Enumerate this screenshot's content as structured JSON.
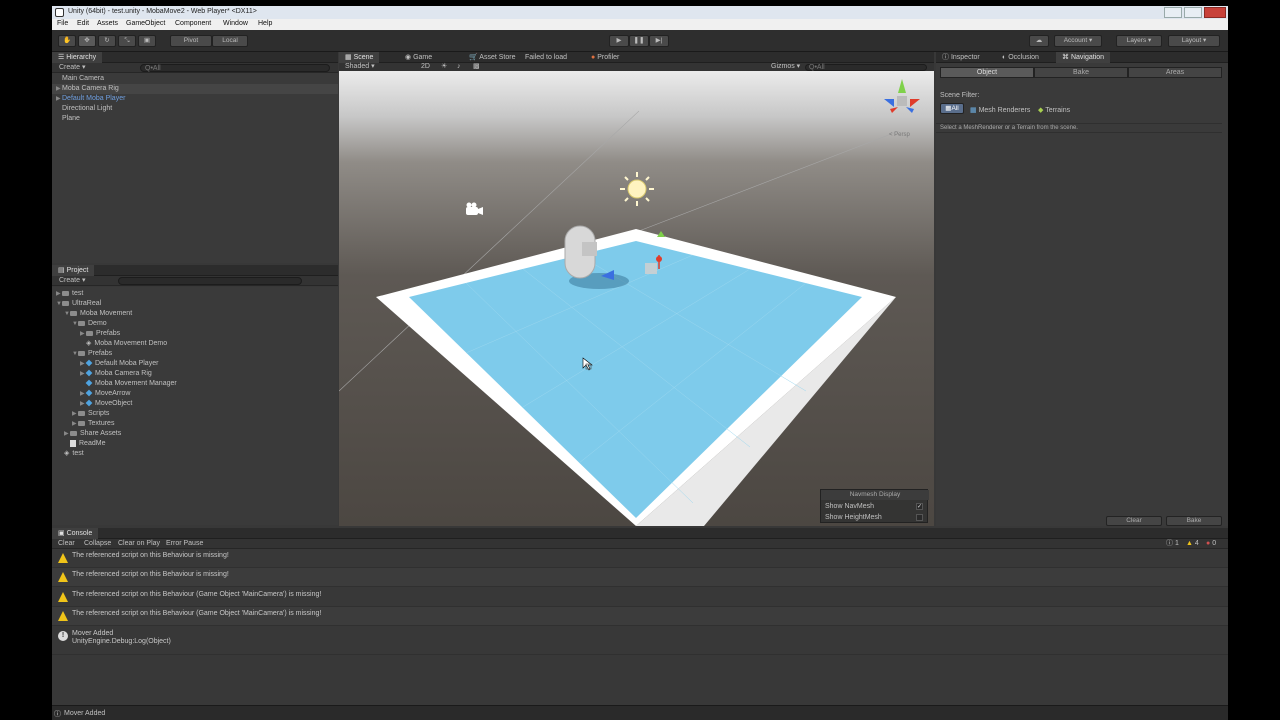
{
  "title": "Unity (64bit) - test.unity - MobaMove2 - Web Player* <DX11>",
  "menu": [
    "File",
    "Edit",
    "Assets",
    "GameObject",
    "Component",
    "Window",
    "Help"
  ],
  "toolbar": {
    "pivot": "Pivot",
    "local": "Local",
    "account": "Account",
    "layers": "Layers",
    "layout": "Layout"
  },
  "hierarchy": {
    "tab": "Hierarchy",
    "create": "Create",
    "search": "Q•All",
    "items": [
      "Main Camera",
      "Moba Camera Rig",
      "Default Moba Player",
      "Directional Light",
      "Plane"
    ]
  },
  "project": {
    "tab": "Project",
    "create": "Create",
    "items": [
      "test",
      "UltraReal",
      "Moba Movement",
      "Demo",
      "Prefabs",
      "Moba Movement Demo",
      "Prefabs",
      "Default Moba Player",
      "Moba Camera Rig",
      "Moba Movement Manager",
      "MoveArrow",
      "MoveObject",
      "Scripts",
      "Textures",
      "Share Assets",
      "ReadMe",
      "test"
    ]
  },
  "center_tabs": {
    "scene": "Scene",
    "game": "Game",
    "asset_store": "Asset Store",
    "failed": "Failed to load",
    "profiler": "Profiler"
  },
  "scene_bar": {
    "shaded": "Shaded",
    "twod": "2D",
    "gizmos": "Gizmos",
    "search": "Q•All",
    "persp": "< Persp"
  },
  "navmesh": {
    "title": "Navmesh Display",
    "show_navmesh": "Show NavMesh",
    "show_heightmesh": "Show HeightMesh"
  },
  "right_tabs": {
    "inspector": "Inspector",
    "occlusion": "Occlusion",
    "navigation": "Navigation"
  },
  "nav_tabs": {
    "object": "Object",
    "bake": "Bake",
    "areas": "Areas"
  },
  "scene_filter": {
    "label": "Scene Filter:",
    "all": "All",
    "mesh": "Mesh Renderers",
    "terrains": "Terrains",
    "hint": "Select a MeshRenderer or a Terrain from the scene."
  },
  "nav_buttons": {
    "clear": "Clear",
    "bake": "Bake"
  },
  "console": {
    "tab": "Console",
    "buttons": [
      "Clear",
      "Collapse",
      "Clear on Play",
      "Error Pause"
    ],
    "counts": {
      "info": "1",
      "warn": "4",
      "error": "0"
    },
    "rows": [
      {
        "type": "warn",
        "text": "The referenced script on this Behaviour is missing!"
      },
      {
        "type": "warn",
        "text": "The referenced script on this Behaviour is missing!"
      },
      {
        "type": "warn",
        "text": "The referenced script on this Behaviour (Game Object 'MainCamera') is missing!"
      },
      {
        "type": "warn",
        "text": "The referenced script on this Behaviour (Game Object 'MainCamera') is missing!"
      },
      {
        "type": "info",
        "text": "Mover Added",
        "text2": "UnityEngine.Debug:Log(Object)"
      }
    ]
  },
  "status": "Mover Added",
  "colors": {
    "accent": "#6f9fe0",
    "navmesh": "#7ecbeb",
    "warning": "#f0c419"
  }
}
